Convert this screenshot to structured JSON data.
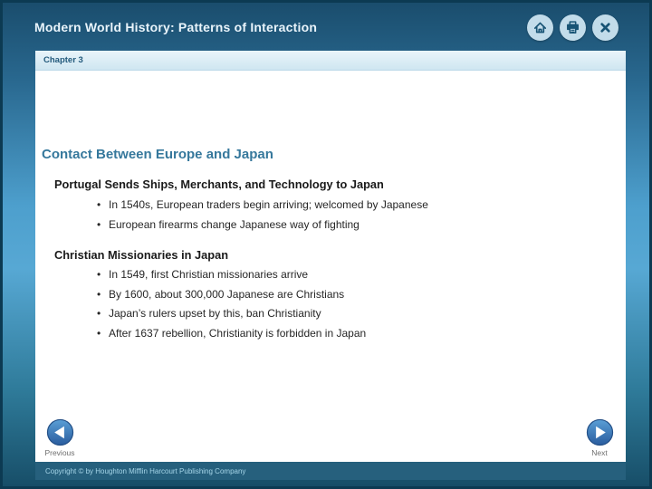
{
  "header": {
    "title": "Modern World History: Patterns of Interaction",
    "icons": {
      "home": "home",
      "print": "print",
      "close": "close"
    }
  },
  "chapter_bar": {
    "label": "Chapter 3"
  },
  "slide": {
    "title": "Contact Between Europe and Japan",
    "sections": [
      {
        "heading": "Portugal Sends Ships, Merchants, and Technology to Japan",
        "bullets": [
          "In 1540s, European traders begin arriving; welcomed by Japanese",
          "European firearms change Japanese way of fighting"
        ]
      },
      {
        "heading": "Christian Missionaries in Japan",
        "bullets": [
          "In 1549, first Christian missionaries arrive",
          "By 1600, about 300,000 Japanese are Christians",
          "Japan’s rulers upset by this, ban Christianity",
          "After 1637 rebellion, Christianity is forbidden in Japan"
        ]
      }
    ]
  },
  "navigation": {
    "previous_label": "Previous",
    "next_label": "Next"
  },
  "footer": {
    "copyright": "Copyright © by Houghton Mifflin Harcourt Publishing Company"
  },
  "ui": {
    "bullet": "•"
  },
  "colors": {
    "accent_heading": "#36789c",
    "header_bg_top": "#1a4d6d",
    "background_mid": "#57a8d4",
    "icon_circle": "#c2dcea",
    "icon_glyph": "#175374",
    "chapter_bar_bg": "#d9ecf5",
    "copyright_bar_bg": "#26607d",
    "nav_button_blue": "#3572b0"
  }
}
